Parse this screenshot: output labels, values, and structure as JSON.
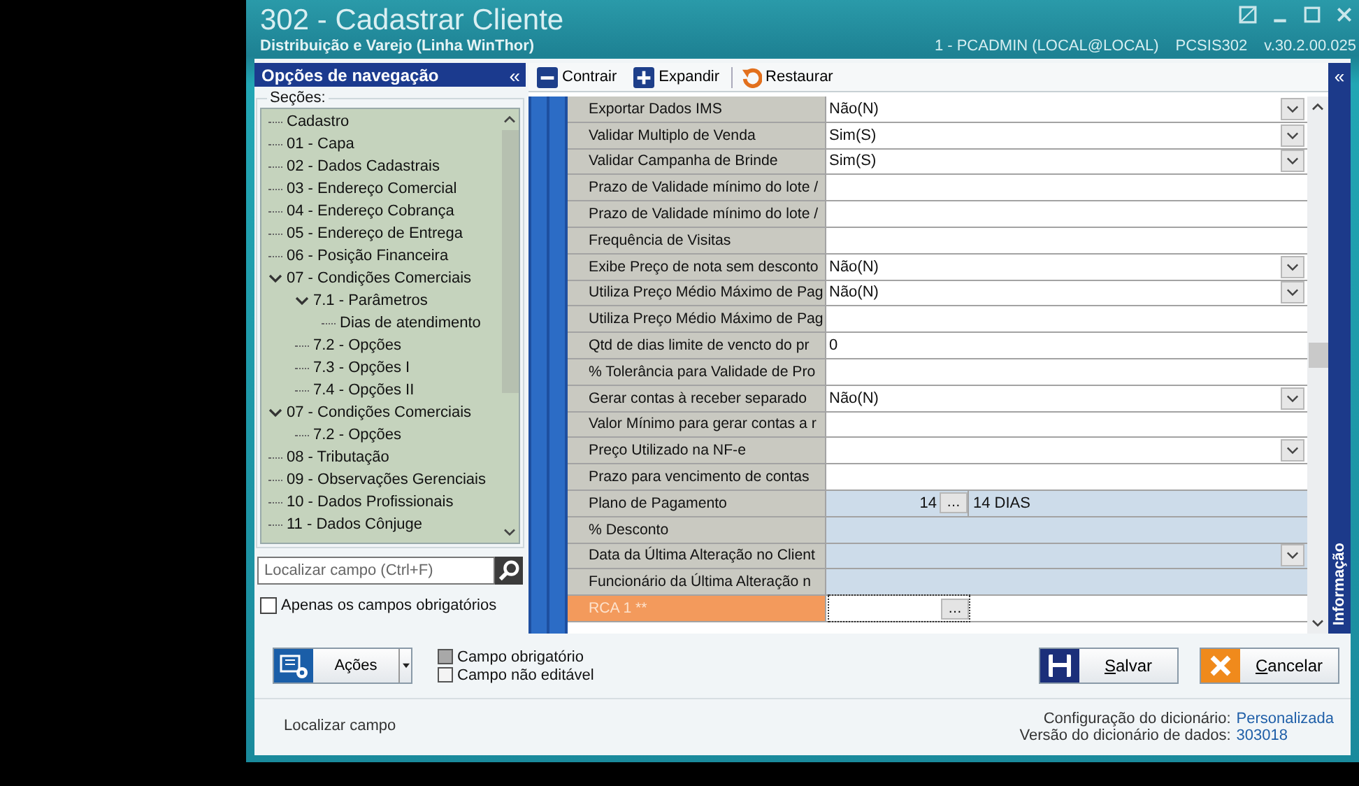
{
  "window": {
    "title": "302 - Cadastrar Cliente",
    "subtitle": "Distribuição e Varejo (Linha WinThor)",
    "session": "1 - PCADMIN (LOCAL@LOCAL)",
    "program": "PCSIS302",
    "version": "v.30.2.00.025"
  },
  "nav": {
    "title": "Opções de navegação",
    "collapse": "«",
    "sections_label": "Seções:",
    "tree": [
      {
        "label": "Cadastro",
        "expanded": false
      },
      {
        "label": "01 - Capa",
        "expanded": false
      },
      {
        "label": "02 - Dados Cadastrais",
        "expanded": false
      },
      {
        "label": "03 - Endereço Comercial",
        "expanded": false
      },
      {
        "label": "04 - Endereço Cobrança",
        "expanded": false
      },
      {
        "label": "05 - Endereço de Entrega",
        "expanded": false
      },
      {
        "label": "06 - Posição Financeira",
        "expanded": false
      },
      {
        "label": "07 - Condições Comerciais",
        "expanded": true,
        "children": [
          {
            "label": "7.1 - Parâmetros",
            "expanded": true,
            "children": [
              {
                "label": "Dias de atendimento",
                "expanded": false
              }
            ]
          },
          {
            "label": "7.2 - Opções",
            "expanded": false
          },
          {
            "label": "7.3 - Opções I",
            "expanded": false
          },
          {
            "label": "7.4 - Opções II",
            "expanded": false
          }
        ]
      },
      {
        "label": "07 - Condições Comerciais",
        "expanded": true,
        "children": [
          {
            "label": "7.2 - Opções",
            "expanded": false
          }
        ]
      },
      {
        "label": "08 - Tributação",
        "expanded": false
      },
      {
        "label": "09 - Observações Gerenciais",
        "expanded": false
      },
      {
        "label": "10 - Dados Profissionais",
        "expanded": false
      },
      {
        "label": "11 - Dados Cônjuge",
        "expanded": false
      }
    ],
    "search": {
      "placeholder": "Localizar campo (Ctrl+F)"
    },
    "required_only": {
      "label": "Apenas os campos obrigatórios",
      "checked": false
    }
  },
  "toolbar": [
    {
      "label": "Contrair",
      "kind": "minus"
    },
    {
      "label": "Expandir",
      "kind": "plus"
    },
    {
      "label": "Restaurar",
      "kind": "restore"
    }
  ],
  "grid": {
    "side_tab": "Informação",
    "rows": [
      {
        "label": "Exportar Dados IMS",
        "value": "Não(N)",
        "kind": "combo",
        "readonly": false,
        "required": false
      },
      {
        "label": "Validar Multiplo de Venda",
        "value": "Sim(S)",
        "kind": "combo",
        "readonly": false,
        "required": false
      },
      {
        "label": "Validar Campanha de Brinde",
        "value": "Sim(S)",
        "kind": "combo",
        "readonly": false,
        "required": false
      },
      {
        "label": "Prazo de Validade mínimo do lote /",
        "kind": "text",
        "readonly": false,
        "required": false
      },
      {
        "label": "Prazo de Validade mínimo do lote /",
        "kind": "text",
        "readonly": false,
        "required": false
      },
      {
        "label": "Frequência de Visitas",
        "kind": "text",
        "readonly": false,
        "required": false
      },
      {
        "label": "Exibe Preço de nota sem desconto",
        "value": "Não(N)",
        "kind": "combo",
        "readonly": false,
        "required": false
      },
      {
        "label": "Utiliza Preço Médio Máximo de Pag",
        "value": "Não(N)",
        "kind": "combo",
        "readonly": false,
        "required": false
      },
      {
        "label": "Utiliza Preço Médio Máximo de Pag",
        "kind": "text",
        "readonly": false,
        "required": false
      },
      {
        "label": "Qtd de dias limite de vencto do pr",
        "value": "0",
        "kind": "text",
        "readonly": false,
        "required": false
      },
      {
        "label": "% Tolerância para Validade de Pro",
        "kind": "text",
        "readonly": false,
        "required": false
      },
      {
        "label": "Gerar contas à receber separado",
        "value": "Não(N)",
        "kind": "combo",
        "readonly": false,
        "required": false
      },
      {
        "label": "Valor Mínimo para gerar contas a r",
        "kind": "text",
        "readonly": false,
        "required": false
      },
      {
        "label": "Preço Utilizado na NF-e",
        "kind": "combo",
        "readonly": false,
        "required": false
      },
      {
        "label": "Prazo para vencimento de contas",
        "kind": "text",
        "readonly": false,
        "required": false
      },
      {
        "label": "Plano de Pagamento",
        "value": "14",
        "button": "…",
        "description": "14 DIAS",
        "kind": "lookup",
        "readonly": true,
        "required": false
      },
      {
        "label": "% Desconto",
        "kind": "text",
        "readonly": true,
        "required": false
      },
      {
        "label": "Data da Última Alteração no Client",
        "kind": "combo",
        "readonly": true,
        "required": false
      },
      {
        "label": "Funcionário da Última Alteração n",
        "kind": "text",
        "readonly": true,
        "required": false
      },
      {
        "label": "RCA 1 **",
        "button": "…",
        "kind": "lookup",
        "readonly": false,
        "required": true
      }
    ]
  },
  "actions": {
    "label": "Ações"
  },
  "legend": [
    {
      "label": "Campo obrigatório",
      "color": "#a8a8a8"
    },
    {
      "label": "Campo não editável",
      "color": "#f4f4f4"
    }
  ],
  "buttons": [
    {
      "label": "Salvar",
      "kind": "save"
    },
    {
      "label": "Cancelar",
      "kind": "cancel"
    }
  ],
  "status": {
    "hint": "Localizar campo",
    "config_label": "Configuração do dicionário:",
    "config_value": "Personalizada",
    "version_label": "Versão do dicionário de dados:",
    "version_value": "303018"
  }
}
